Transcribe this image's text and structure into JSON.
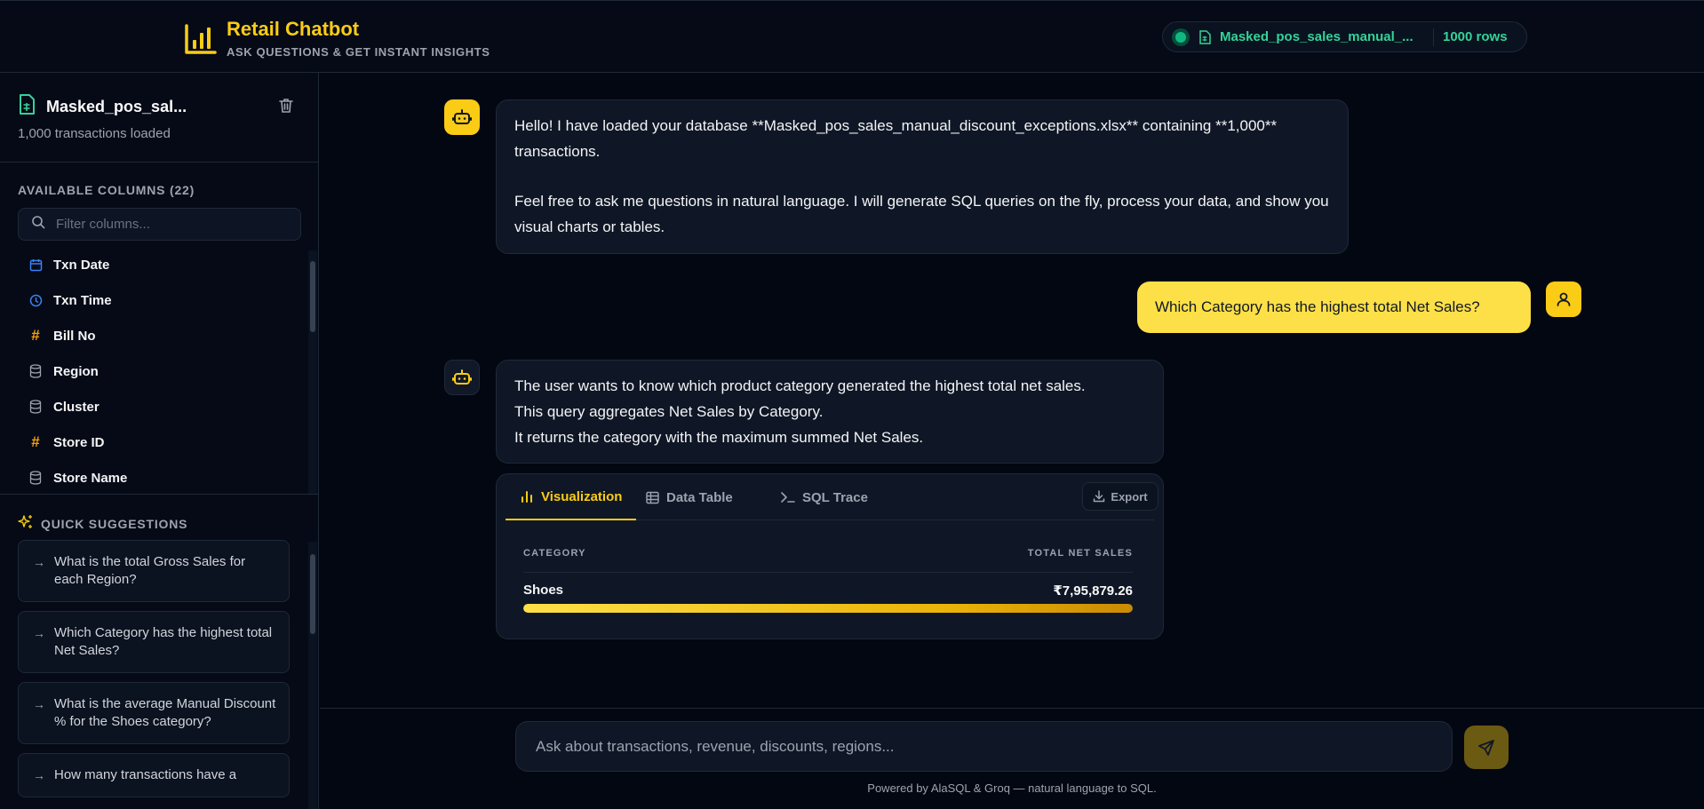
{
  "header": {
    "title": "Retail Chatbot",
    "subtitle": "ASK QUESTIONS & GET INSTANT INSIGHTS",
    "db_name": "Masked_pos_sales_manual_...",
    "db_rows": "1000 rows"
  },
  "sidebar": {
    "file_name": "Masked_pos_sal...",
    "file_sub": "1,000 transactions loaded",
    "columns_label": "AVAILABLE COLUMNS (22)",
    "filter_placeholder": "Filter columns...",
    "columns": [
      {
        "label": "Txn Date",
        "icon": "calendar-icon"
      },
      {
        "label": "Txn Time",
        "icon": "clock-icon"
      },
      {
        "label": "Bill No",
        "icon": "hash-icon"
      },
      {
        "label": "Region",
        "icon": "database-icon"
      },
      {
        "label": "Cluster",
        "icon": "database-icon"
      },
      {
        "label": "Store ID",
        "icon": "hash-icon"
      },
      {
        "label": "Store Name",
        "icon": "database-icon"
      }
    ],
    "suggestions_label": "QUICK SUGGESTIONS",
    "suggestions": [
      "What is the total Gross Sales for each Region?",
      "Which Category has the highest total Net Sales?",
      "What is the average Manual Discount % for the Shoes category?",
      "How many transactions have a"
    ]
  },
  "chat": {
    "bot_welcome_1": "Hello! I have loaded your database **Masked_pos_sales_manual_discount_exceptions.xlsx** containing **1,000** transactions.",
    "bot_welcome_2": "Feel free to ask me questions in natural language. I will generate SQL queries on the fly, process your data, and show you visual charts or tables.",
    "user_question": "Which Category has the highest total Net Sales?",
    "bot_answer_lines": [
      "The user wants to know which product category generated the highest total net sales.",
      "This query aggregates Net Sales by Category.",
      "It returns the category with the maximum summed Net Sales."
    ]
  },
  "result": {
    "tabs": [
      "Visualization",
      "Data Table",
      "SQL Trace"
    ],
    "active_tab": "Visualization",
    "export_label": "Export",
    "col_category": "CATEGORY",
    "col_value": "TOTAL NET SALES",
    "rows": [
      {
        "category": "Shoes",
        "value": "₹7,95,879.26",
        "fill_fraction": 1.0
      }
    ]
  },
  "composer": {
    "placeholder": "Ask about transactions, revenue, discounts, regions...",
    "footer": "Powered by AlaSQL & Groq — natural language to SQL."
  },
  "colors": {
    "accent": "#facc15",
    "success": "#10b981",
    "background": "#030712"
  }
}
